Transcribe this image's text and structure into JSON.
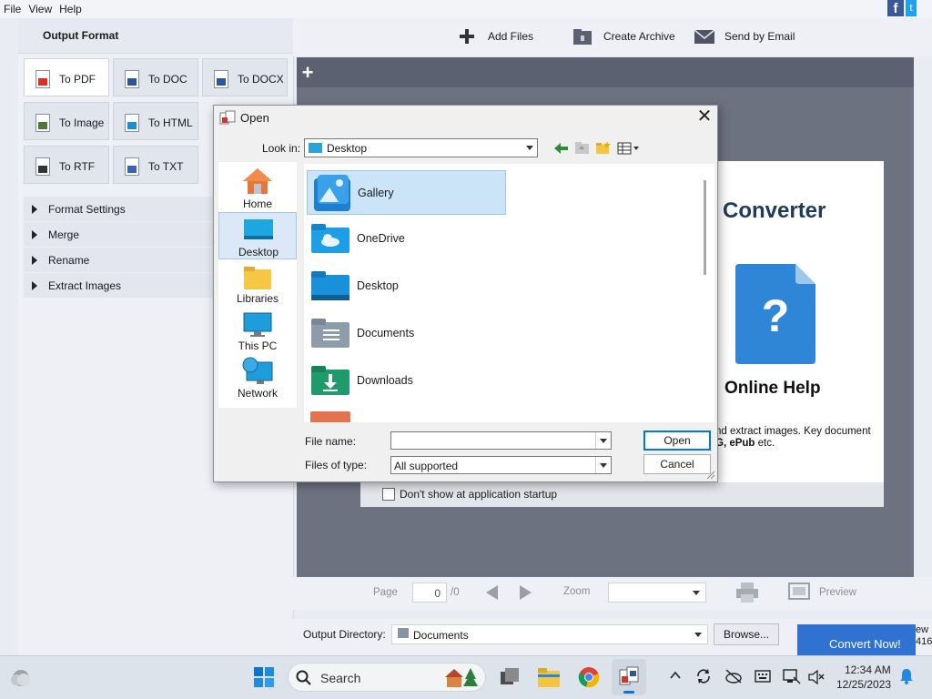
{
  "menubar": {
    "items": [
      "File",
      "View",
      "Help"
    ]
  },
  "social": {
    "facebook": "f",
    "twitter": "t"
  },
  "left_panel": {
    "title": "Output Format",
    "formats": [
      {
        "label": "To PDF",
        "color": "#d9302c"
      },
      {
        "label": "To DOC",
        "color": "#2b579a"
      },
      {
        "label": "To DOCX",
        "color": "#2b579a"
      },
      {
        "label": "To Image",
        "color": "#4a7a3a"
      },
      {
        "label": "To HTML",
        "color": "#1e8fd6"
      },
      {
        "label": "To RTF",
        "color": "#333333"
      },
      {
        "label": "To TXT",
        "color": "#3a63b8"
      }
    ],
    "sections": [
      "Format Settings",
      "Merge",
      "Rename",
      "Extract Images"
    ]
  },
  "toolbar": {
    "add_files": "Add Files",
    "create_archive": "Create Archive",
    "send_email": "Send by Email"
  },
  "tabs": {
    "add_tab": "+"
  },
  "welcome": {
    "title": "Converter",
    "help_glyph": "?",
    "online_help": "Online Help",
    "desc_line1": "nd extract images. Key document",
    "desc_line2_bold": "G, ePub",
    "desc_line2_rest": " etc.",
    "dont_show": "Don't show at application startup"
  },
  "navigation": {
    "page_label": "Page",
    "page_value": "0",
    "page_total": "/0",
    "zoom_label": "Zoom",
    "zoom_value": "",
    "preview_label": "Preview"
  },
  "output": {
    "directory_label": "Output Directory:",
    "directory_value": "Documents",
    "browse_label": "Browse...",
    "convert_label": "Convert Now!",
    "edge_text1": "ew",
    "edge_text2": "416"
  },
  "dialog": {
    "title": "Open",
    "close": "✕",
    "look_in_label": "Look in:",
    "look_in_value": "Desktop",
    "places": [
      "Home",
      "Desktop",
      "Libraries",
      "This PC",
      "Network"
    ],
    "files": [
      "Gallery",
      "OneDrive",
      "Desktop",
      "Documents",
      "Downloads"
    ],
    "file_name_label": "File name:",
    "file_name_value": "",
    "file_type_label": "Files of type:",
    "file_type_value": "All supported",
    "open_button": "Open",
    "cancel_button": "Cancel"
  },
  "taskbar": {
    "search_placeholder": "Search",
    "time": "12:34 AM",
    "date": "12/25/2023"
  }
}
